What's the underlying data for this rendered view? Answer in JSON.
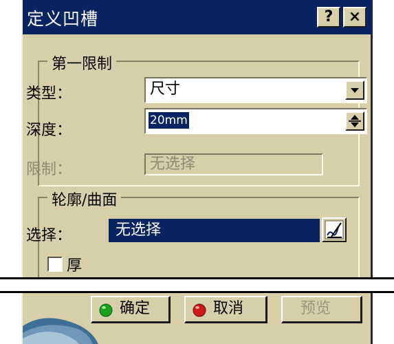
{
  "window": {
    "title": "定义凹槽",
    "help_label": "?",
    "close_label": "×"
  },
  "first_limit": {
    "legend": "第一限制",
    "type_label": "类型：",
    "type_value": "尺寸",
    "depth_label": "深度：",
    "depth_value": "20mm",
    "limit_label": "限制：",
    "limit_value": "无选择"
  },
  "profile": {
    "legend": "轮廓/曲面",
    "select_label": "选择：",
    "select_value": "无选择",
    "thick_label": "厚",
    "thick_checked": false
  },
  "buttons": {
    "ok": "确定",
    "cancel": "取消",
    "preview": "预览"
  },
  "colors": {
    "ok_icon": "#1aa01a",
    "cancel_icon": "#cc1a1a",
    "accent": "#0a2463"
  }
}
